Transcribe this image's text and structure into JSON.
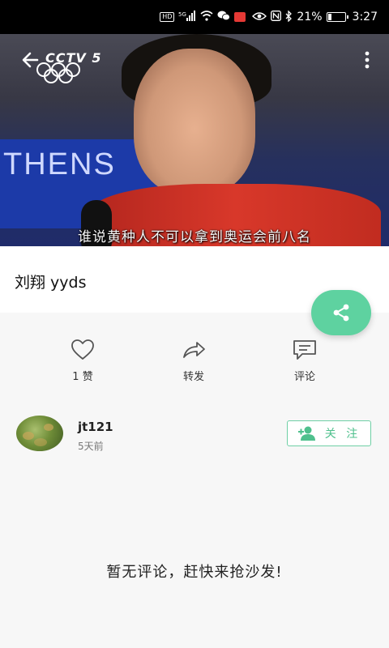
{
  "status_bar": {
    "network_labels": [
      "HD",
      "5G"
    ],
    "battery_percent": 21,
    "battery_text": "21%",
    "time": "3:27",
    "icons": [
      "hd-icon",
      "signal-icon",
      "wifi-icon",
      "wechat-icon",
      "app-icon",
      "eye-icon",
      "nfc-icon",
      "bluetooth-icon",
      "battery-icon"
    ]
  },
  "video": {
    "channel_logo": "CCTV 5",
    "banner_text": "THENS",
    "subtitle": "谁说黄种人不可以拿到奥运会前八名",
    "back_icon": "arrow-left-icon",
    "more_icon": "more-vertical-icon"
  },
  "post": {
    "title": "刘翔 yyds"
  },
  "share": {
    "icon": "share-icon",
    "color": "#5ed2a0"
  },
  "actions": {
    "like_label": "1 赞",
    "forward_label": "转发",
    "comment_label": "评论"
  },
  "author": {
    "name": "jt121",
    "time": "5天前",
    "follow_label": "关 注",
    "accent": "#4fc08d"
  },
  "comments": {
    "empty_text": "暂无评论，赶快来抢沙发!"
  }
}
